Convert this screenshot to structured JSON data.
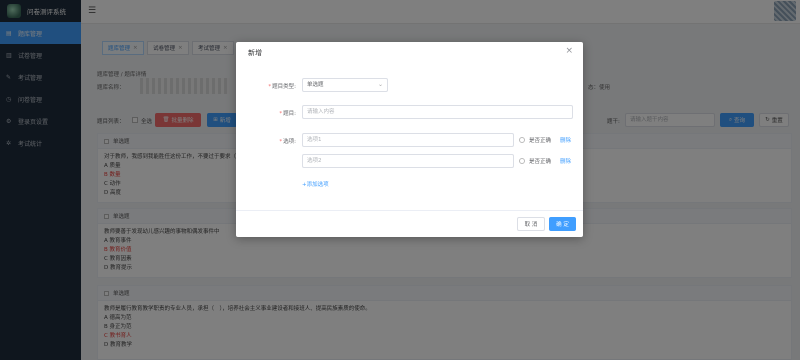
{
  "app": {
    "title": "问卷测评系统"
  },
  "sidebar": {
    "items": [
      {
        "label": "题库管理",
        "icon": "document-icon",
        "active": true
      },
      {
        "label": "试卷管理",
        "icon": "paper-icon",
        "active": false
      },
      {
        "label": "考试管理",
        "icon": "edit-icon",
        "active": false
      },
      {
        "label": "问卷管理",
        "icon": "clock-icon",
        "active": false
      },
      {
        "label": "登录页设置",
        "icon": "settings-icon",
        "active": false
      },
      {
        "label": "考试统计",
        "icon": "gear-icon",
        "active": false
      }
    ]
  },
  "tabs": [
    {
      "label": "题库管理",
      "active": true
    },
    {
      "label": "试卷管理",
      "active": false
    },
    {
      "label": "考试管理",
      "active": false
    }
  ],
  "page": {
    "breadcrumb": "题库管理 / 题库详情",
    "bank_name_label": "题库名称：",
    "right_info": "态：使用"
  },
  "toolbar": {
    "list_label": "题目列表：",
    "select_all": "全选",
    "batch_delete": "批量删除",
    "add": "新增",
    "keyword_label": "题干:",
    "keyword_placeholder": "请输入题干内容",
    "search": "查询",
    "reset": "重置"
  },
  "questions": [
    {
      "type": "单选题",
      "stem": "对于教师，我感到我能胜任这份工作，不要过于要求（",
      "options": [
        {
          "text": "A  质量",
          "correct": false
        },
        {
          "text": "B  数量",
          "correct": true
        },
        {
          "text": "C  动作",
          "correct": false
        },
        {
          "text": "D  高度",
          "correct": false
        }
      ]
    },
    {
      "type": "单选题",
      "stem": "教师要善于发现幼儿感兴趣的事物和偶发事件中",
      "options": [
        {
          "text": "A  教育事件",
          "correct": false
        },
        {
          "text": "B  教育价值",
          "correct": true
        },
        {
          "text": "C  教育因素",
          "correct": false
        },
        {
          "text": "D  教育提示",
          "correct": false
        }
      ]
    },
    {
      "type": "单选题",
      "stem": "教师是履行教育教学职责的专业人员，承担（　），培养社会主义事业建设者和接班人、提高民族素质的使命。",
      "options": [
        {
          "text": "A  德高为范",
          "correct": false
        },
        {
          "text": "B  身正为范",
          "correct": false
        },
        {
          "text": "C  教书育人",
          "correct": true
        },
        {
          "text": "D  教育教学",
          "correct": false
        }
      ]
    }
  ],
  "dialog": {
    "title": "新增",
    "type_label": "题目类型:",
    "type_value": "单选题",
    "question_label": "题目:",
    "question_placeholder": "请输入内容",
    "options_label": "选项:",
    "options": [
      {
        "placeholder": "选项1",
        "correct_label": "是否正确",
        "delete_label": "删除"
      },
      {
        "placeholder": "选项2",
        "correct_label": "是否正确",
        "delete_label": "删除"
      }
    ],
    "add_option": "+添加选项",
    "cancel": "取 消",
    "confirm": "确 定"
  },
  "colors": {
    "primary": "#409eff",
    "danger": "#f56c6c",
    "sidebar": "#1f2d3d"
  }
}
